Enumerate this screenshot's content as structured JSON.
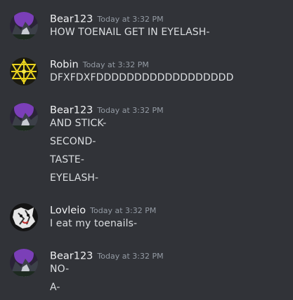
{
  "messages": [
    {
      "username": "Bear123",
      "timestamp": "Today at 3:32 PM",
      "avatar_icon": "bear-avatar-icon",
      "lines": [
        "HOW TOENAIL GET IN EYELASH-"
      ]
    },
    {
      "username": "Robin",
      "timestamp": "Today at 3:32 PM",
      "avatar_icon": "robin-avatar-icon",
      "lines": [
        "DFXFDXFDDDDDDDDDDDDDDDDDD"
      ]
    },
    {
      "username": "Bear123",
      "timestamp": "Today at 3:32 PM",
      "avatar_icon": "bear-avatar-icon",
      "lines": [
        "AND STICK-",
        "SECOND-",
        "TASTE-",
        "EYELASH-"
      ]
    },
    {
      "username": "Lovleio",
      "timestamp": "Today at 3:32 PM",
      "avatar_icon": "lovleio-avatar-icon",
      "lines": [
        "I eat my toenails-"
      ]
    },
    {
      "username": "Bear123",
      "timestamp": "Today at 3:32 PM",
      "avatar_icon": "bear-avatar-icon",
      "lines": [
        "NO-",
        "A-"
      ]
    }
  ],
  "colors": {
    "background": "#313338",
    "username": "#f2f3f5",
    "timestamp": "#949ba4",
    "text": "#dbdee1"
  }
}
